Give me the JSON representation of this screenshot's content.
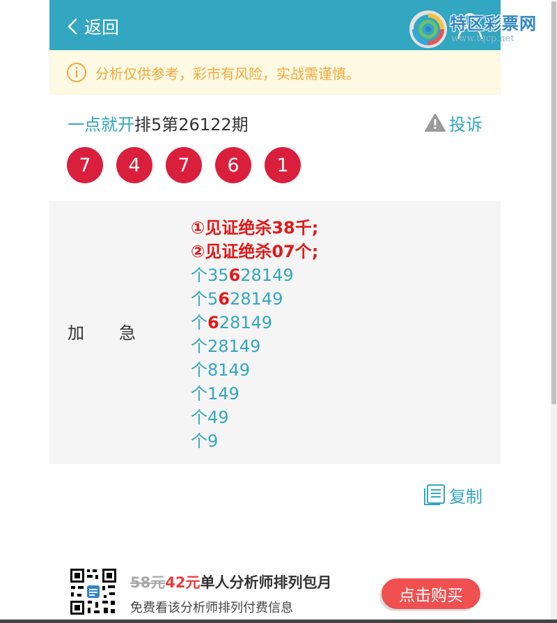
{
  "header": {
    "back_label": "返回",
    "bg_color": "#33a6c1"
  },
  "watermark": {
    "title": "特区彩票网",
    "url": "www.tqcp.net"
  },
  "notice": {
    "text": "分析仅供参考，彩市有风险，实战需谨慎。",
    "color": "#f2a93b"
  },
  "post": {
    "author": "一点就开",
    "issue": "排5第26122期",
    "complain_label": "投诉"
  },
  "balls": [
    "7",
    "4",
    "7",
    "6",
    "1"
  ],
  "panel": {
    "label": "加急",
    "lines": [
      {
        "type": "kill",
        "parts": [
          {
            "t": "①见证绝杀38千;",
            "h": false
          }
        ]
      },
      {
        "type": "kill",
        "parts": [
          {
            "t": "②见证绝杀07个;",
            "h": false
          }
        ]
      },
      {
        "type": "normal",
        "parts": [
          {
            "t": "个35",
            "h": false
          },
          {
            "t": "6",
            "h": true
          },
          {
            "t": "28149",
            "h": false
          }
        ]
      },
      {
        "type": "normal",
        "parts": [
          {
            "t": "个5",
            "h": false
          },
          {
            "t": "6",
            "h": true
          },
          {
            "t": "28149",
            "h": false
          }
        ]
      },
      {
        "type": "normal",
        "parts": [
          {
            "t": "个",
            "h": false
          },
          {
            "t": "6",
            "h": true
          },
          {
            "t": "28149",
            "h": false
          }
        ]
      },
      {
        "type": "normal",
        "parts": [
          {
            "t": "个28149",
            "h": false
          }
        ]
      },
      {
        "type": "normal",
        "parts": [
          {
            "t": "个8149",
            "h": false
          }
        ]
      },
      {
        "type": "normal",
        "parts": [
          {
            "t": "个149",
            "h": false
          }
        ]
      },
      {
        "type": "normal",
        "parts": [
          {
            "t": "个49",
            "h": false
          }
        ]
      },
      {
        "type": "normal",
        "parts": [
          {
            "t": "个9",
            "h": false
          }
        ]
      }
    ]
  },
  "copy_label": "复制",
  "promo": {
    "old_price": "58元",
    "new_price": "42元",
    "title": "单人分析师排列包月",
    "subtitle": "免费看该分析师排列付费信息",
    "buy_label": "点击购买"
  },
  "colors": {
    "accent": "#33a6c1",
    "ball": "#da1f3d",
    "highlight": "#e21919",
    "buy_button": "#f05050"
  }
}
